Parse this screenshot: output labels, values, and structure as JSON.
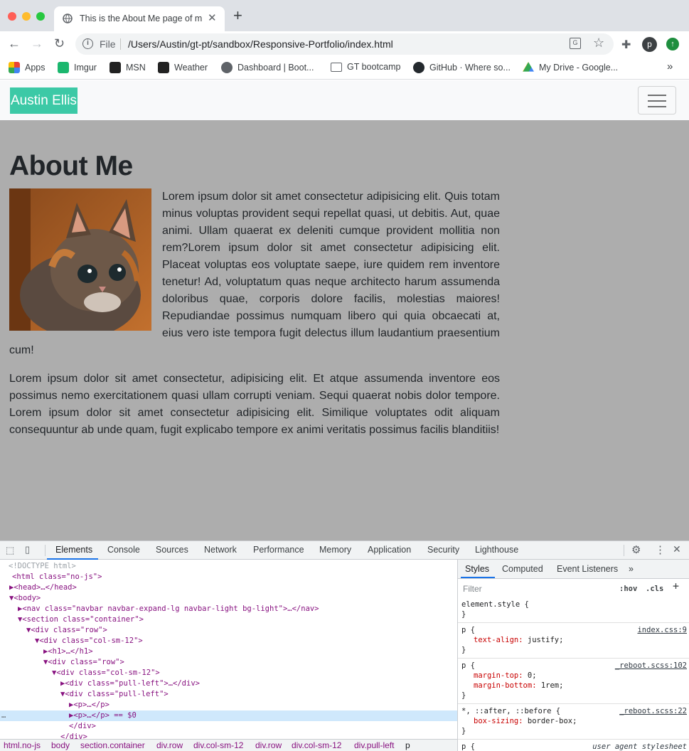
{
  "browser": {
    "tab_title": "This is the About Me page of my portfolio",
    "new_tab": "+",
    "close": "✕",
    "omnibox": {
      "scheme": "File",
      "url": "/Users/Austin/gt-pt/sandbox/Responsive-Portfolio/index.html"
    },
    "profile_initial": "p",
    "bookmarks": [
      {
        "label": "Apps",
        "icon": "apps-icon"
      },
      {
        "label": "Imgur",
        "icon": "imgur-icon"
      },
      {
        "label": "MSN",
        "icon": "msn-icon"
      },
      {
        "label": "Weather",
        "icon": "weather-icon"
      },
      {
        "label": "Dashboard | Boot...",
        "icon": "globe-icon"
      },
      {
        "label": "GT bootcamp",
        "icon": "folder-icon"
      },
      {
        "label": "GitHub · Where so...",
        "icon": "github-icon"
      },
      {
        "label": "My Drive - Google...",
        "icon": "drive-icon"
      }
    ],
    "bookmarks_more": "»"
  },
  "site": {
    "brand": "Austin Ellis",
    "heading": "About Me",
    "paragraph1": "Lorem ipsum dolor sit amet consectetur adipisicing elit. Quis totam minus voluptas provident sequi repellat quasi, ut debitis. Aut, quae animi. Ullam quaerat ex deleniti cumque provident mollitia non rem?Lorem ipsum dolor sit amet consectetur adipisicing elit. Placeat voluptas eos voluptate saepe, iure quidem rem inventore tenetur! Ad, voluptatum quas neque architecto harum assumenda doloribus quae, corporis dolore facilis, molestias maiores! Repudiandae possimus numquam libero qui quia obcaecati at, eius vero iste tempora fugit delectus illum laudantium praesentium cum!",
    "paragraph2": "Lorem ipsum dolor sit amet consectetur, adipisicing elit. Et atque assumenda inventore eos possimus nemo exercitationem quasi ullam corrupti veniam. Sequi quaerat nobis dolor tempore. Lorem ipsum dolor sit amet consectetur adipisicing elit. Similique voluptates odit aliquam consequuntur ab unde quam, fugit explicabo tempore ex animi veritatis possimus facilis blanditiis!"
  },
  "devtools": {
    "tabs": [
      "Elements",
      "Console",
      "Sources",
      "Network",
      "Performance",
      "Memory",
      "Application",
      "Security",
      "Lighthouse"
    ],
    "dom_lines": [
      "<!DOCTYPE html>",
      "<html class=\"no-js\">",
      "▶<head>…</head>",
      "▼<body>",
      "▶<nav class=\"navbar navbar-expand-lg navbar-light bg-light\">…</nav>",
      "▼<section class=\"container\">",
      "▼<div class=\"row\">",
      "▼<div class=\"col-sm-12\">",
      "▶<h1>…</h1>",
      "▼<div class=\"row\">",
      "▼<div class=\"col-sm-12\">",
      "▶<div class=\"pull-left\">…</div>",
      "▼<div class=\"pull-left\">",
      "▶<p>…</p>",
      "▶<p>…</p> == $0",
      "</div>",
      "</div>"
    ],
    "selected_marker": "…",
    "styles_tabs": [
      "Styles",
      "Computed",
      "Event Listeners",
      "»"
    ],
    "filter_placeholder": "Filter",
    "hov": ":hov",
    "cls": ".cls",
    "add": "+",
    "rules": [
      {
        "selector": "element.style {",
        "source": "",
        "decls": [],
        "close": "}"
      },
      {
        "selector": "p {",
        "source": "index.css:9",
        "decls": [
          {
            "prop": "text-align",
            "val": "justify;"
          }
        ],
        "close": "}"
      },
      {
        "selector": "p {",
        "source": "_reboot.scss:102",
        "decls": [
          {
            "prop": "margin-top",
            "val": "0;"
          },
          {
            "prop": "margin-bottom",
            "val": "1rem;"
          }
        ],
        "close": "}"
      },
      {
        "selector": "*, ::after, ::before {",
        "source": "_reboot.scss:22",
        "decls": [
          {
            "prop": "box-sizing",
            "val": "border-box;"
          }
        ],
        "close": "}"
      },
      {
        "selector": "p {",
        "source": "user agent stylesheet",
        "decls": [],
        "close": ""
      }
    ],
    "breadcrumbs": [
      "html.no-js",
      "body",
      "section.container",
      "div.row",
      "div.col-sm-12",
      "div.row",
      "div.col-sm-12",
      "div.pull-left",
      "p"
    ]
  }
}
